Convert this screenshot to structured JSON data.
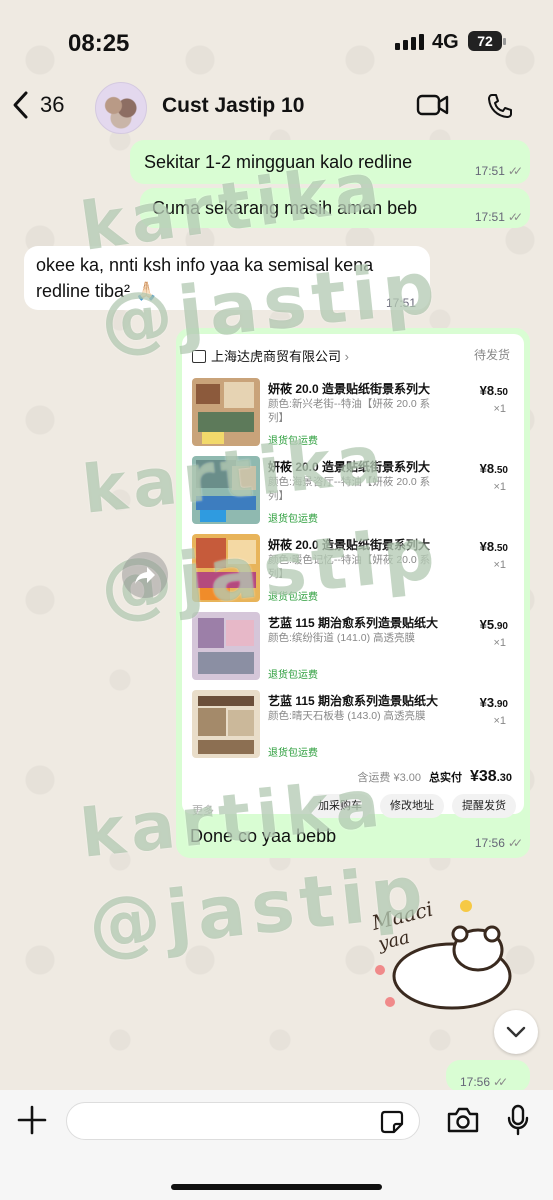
{
  "status_bar": {
    "time": "08:25",
    "network": "4G",
    "battery": "72"
  },
  "header": {
    "back_count": "36",
    "contact_name": "Cust Jastip 10"
  },
  "watermark": {
    "line1": "kartika",
    "line2": "@jastip"
  },
  "messages": [
    {
      "direction": "out",
      "text": "Sekitar 1-2 mingguan kalo redline",
      "time": "17:51"
    },
    {
      "direction": "out",
      "text": "Cuma sekarang masih aman beb",
      "time": "17:51"
    },
    {
      "direction": "in",
      "text": "okee ka, nnti ksh info yaa ka semisal kena redline tiba² 🙏🏻",
      "time": "17:51"
    },
    {
      "direction": "out",
      "text": "Done co yaa bebb",
      "time": "17:56"
    },
    {
      "direction": "out",
      "text": "",
      "time": "17:56"
    }
  ],
  "order": {
    "shop": "上海达虎商贸有限公司",
    "status": "待发货",
    "items": [
      {
        "title": "妍莜 20.0 造景贴纸街景系列大",
        "spec": "颜色:新兴老街--特油【妍莜 20.0 系列】",
        "tag": "退货包运费",
        "price_int": "8",
        "price_dec": ".50",
        "qty": "×1"
      },
      {
        "title": "妍莜 20.0 造景贴纸街景系列大",
        "spec": "颜色:海景咨厅--特油【妍莜 20.0 系列】",
        "tag": "退货包运费",
        "price_int": "8",
        "price_dec": ".50",
        "qty": "×1"
      },
      {
        "title": "妍莜 20.0 造景贴纸街景系列大",
        "spec": "颜色:暖色记忆--特油【妍莜 20.0 系列】",
        "tag": "退货包运费",
        "price_int": "8",
        "price_dec": ".50",
        "qty": "×1"
      },
      {
        "title": "艺蓝 115 期治愈系列造景贴纸大",
        "spec": "颜色:缤纷街道 (141.0) 高透亮膜",
        "tag": "退货包运费",
        "price_int": "5",
        "price_dec": ".90",
        "qty": "×1"
      },
      {
        "title": "艺蓝 115 期治愈系列造景贴纸大",
        "spec": "颜色:晴天石板巷 (143.0) 高透亮膜",
        "tag": "退货包运费",
        "price_int": "3",
        "price_dec": ".90",
        "qty": "×1"
      }
    ],
    "shipping": "含运费 ¥3.00",
    "total_label": "总实付",
    "total_int": "¥38",
    "total_dec": ".30",
    "more": "更多",
    "buttons": [
      "加采购车",
      "修改地址",
      "提醒发货"
    ]
  },
  "sticker": {
    "text1": "Maaci",
    "text2": "yaa"
  },
  "icons": [
    "back-chevron-icon",
    "video-call-icon",
    "phone-icon",
    "forward-icon",
    "chevron-down-icon",
    "plus-icon",
    "sticker-icon",
    "camera-icon",
    "mic-icon"
  ]
}
